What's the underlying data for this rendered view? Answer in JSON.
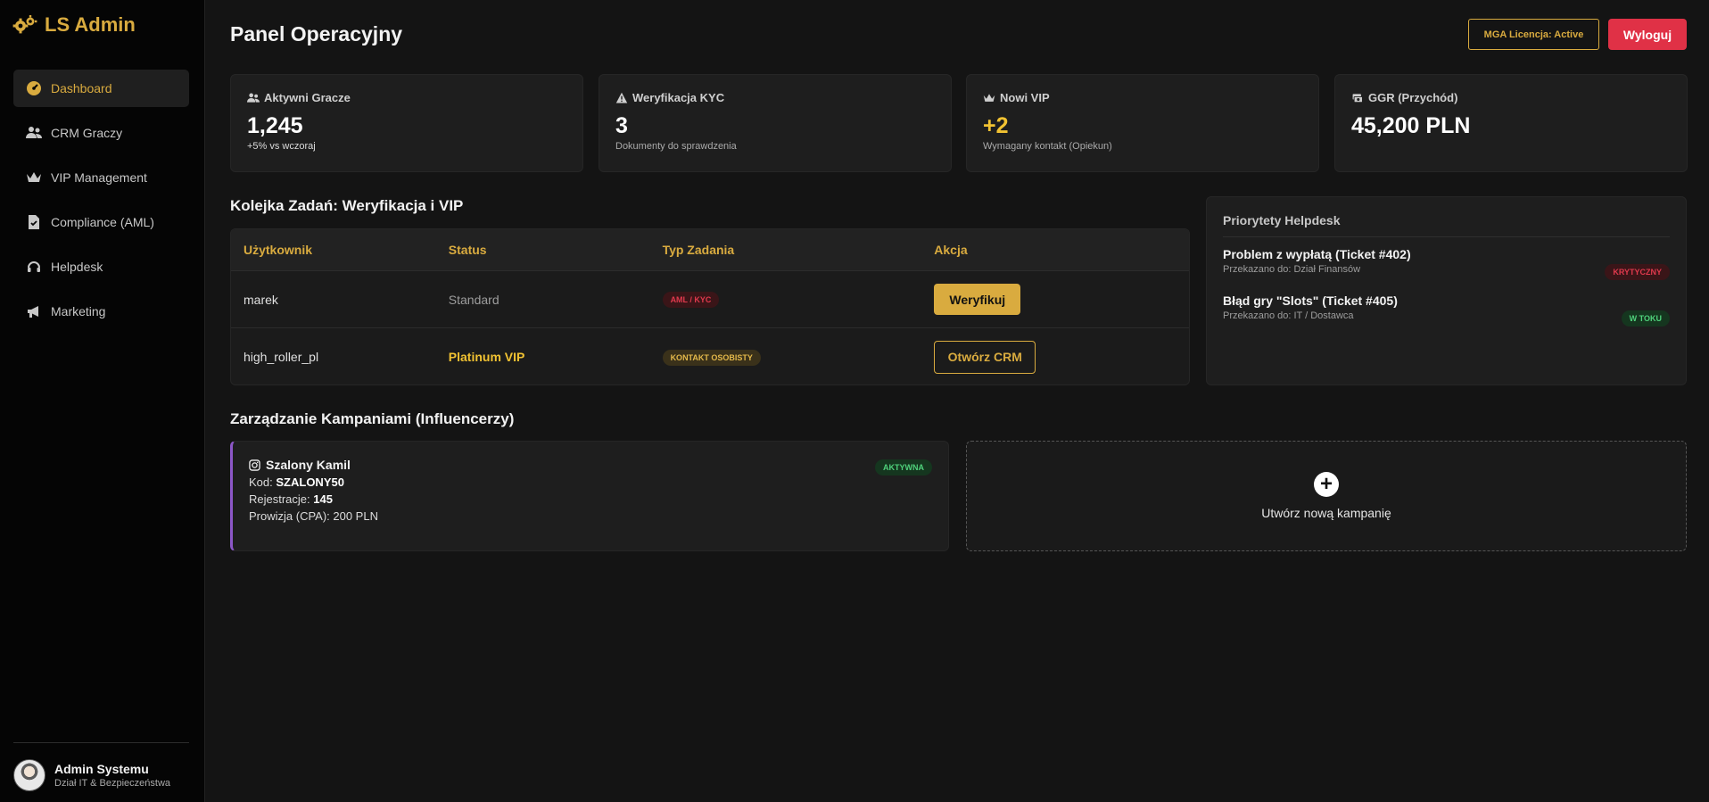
{
  "app": {
    "logo_text": "LS Admin"
  },
  "sidebar": {
    "items": [
      {
        "label": "Dashboard",
        "icon": "dashboard-icon",
        "active": true
      },
      {
        "label": "CRM Graczy",
        "icon": "users-icon"
      },
      {
        "label": "VIP Management",
        "icon": "crown-icon"
      },
      {
        "label": "Compliance (AML)",
        "icon": "file-check-icon"
      },
      {
        "label": "Helpdesk",
        "icon": "headset-icon"
      },
      {
        "label": "Marketing",
        "icon": "megaphone-icon"
      }
    ],
    "user": {
      "name": "Admin Systemu",
      "role": "Dział IT & Bezpieczeństwa"
    }
  },
  "header": {
    "title": "Panel Operacyjny",
    "license_label": "MGA Licencja: Active",
    "logout_label": "Wyloguj"
  },
  "stats": [
    {
      "label": "Aktywni Gracze",
      "icon": "users-icon",
      "value": "1,245",
      "sub": "+5% vs wczoraj"
    },
    {
      "label": "Weryfikacja KYC",
      "icon": "warning-icon",
      "value": "3",
      "sub": "Dokumenty do sprawdzenia"
    },
    {
      "label": "Nowi VIP",
      "icon": "crown-icon",
      "value": "+2",
      "sub": "Wymagany kontakt (Opiekun)"
    },
    {
      "label": "GGR (Przychód)",
      "icon": "money-icon",
      "value": "45,200 PLN",
      "sub": ""
    }
  ],
  "tasks": {
    "title": "Kolejka Zadań: Weryfikacja i VIP",
    "headers": [
      "Użytkownik",
      "Status",
      "Typ Zadania",
      "Akcja"
    ],
    "rows": [
      {
        "user": "marek",
        "status": "Standard",
        "type": "AML / KYC",
        "action": "Weryfikuj"
      },
      {
        "user": "high_roller_pl",
        "status": "Platinum VIP",
        "type": "Kontakt Osobisty",
        "action": "Otwórz CRM"
      }
    ]
  },
  "helpdesk": {
    "title": "Priorytety Helpdesk",
    "items": [
      {
        "title": "Problem z wypłatą (Ticket #402)",
        "sub": "Przekazano do: Dział Finansów",
        "badge": "Krytyczny"
      },
      {
        "title": "Błąd gry \"Slots\" (Ticket #405)",
        "sub": "Przekazano do: IT / Dostawca",
        "badge": "W toku"
      }
    ]
  },
  "campaigns": {
    "title": "Zarządzanie Kampaniami (Influencerzy)",
    "card": {
      "name": "Szalony Kamil",
      "badge": "Aktywna",
      "code_label": "Kod:",
      "code_value": "SZALONY50",
      "reg_label": "Rejestracje:",
      "reg_value": "145",
      "cpa_text": "Prowizja (CPA): 200 PLN"
    },
    "new_label": "Utwórz nową kampanię"
  },
  "colors": {
    "accent": "#d9ab3f",
    "danger": "#e03146",
    "vip": "#f1c232",
    "campaign_border": "#8c57c7"
  }
}
